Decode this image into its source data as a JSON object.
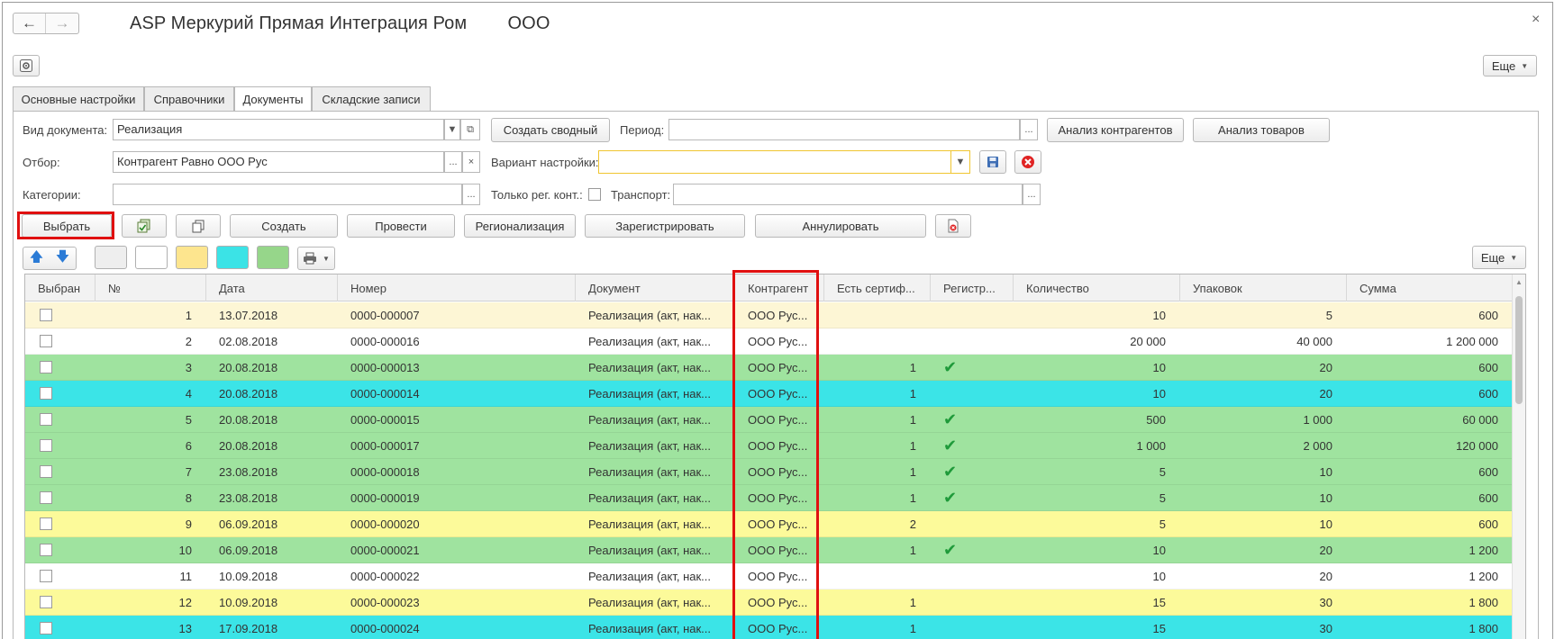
{
  "window": {
    "title": "ASP Меркурий Прямая Интеграция Ром        ООО",
    "more_label": "Еще",
    "close_glyph": "×"
  },
  "tabs": [
    {
      "label": "Основные настройки",
      "active": false
    },
    {
      "label": "Справочники",
      "active": false
    },
    {
      "label": "Документы",
      "active": true
    },
    {
      "label": "Складские записи",
      "active": false
    }
  ],
  "filters": {
    "doc_type_label": "Вид документа:",
    "doc_type_value": "Реализация",
    "create_summary_label": "Создать сводный",
    "period_label": "Период:",
    "period_value": "",
    "analyze_counterparties_label": "Анализ контрагентов",
    "analyze_goods_label": "Анализ товаров",
    "selection_label": "Отбор:",
    "selection_value": "Контрагент Равно  ООО Рус",
    "setting_variant_label": "Вариант настройки:",
    "setting_variant_value": "",
    "categories_label": "Категории:",
    "categories_value": "",
    "only_reg_label": "Только рег. конт.:",
    "transport_label": "Транспорт:",
    "transport_value": "",
    "ellipsis": "...",
    "clear": "×"
  },
  "actions": {
    "select": "Выбрать",
    "create": "Создать",
    "post": "Провести",
    "regionalize": "Регионализация",
    "register": "Зарегистрировать",
    "annul": "Аннулировать"
  },
  "table_toolbar": {
    "more_label": "Еще",
    "colors": [
      "#eeeeee",
      "#ffffff",
      "#fde58e",
      "#3be3e6",
      "#96d68a"
    ]
  },
  "colors": {
    "white": "#ffffff",
    "light_yellow": "#fdf6d5",
    "yellow": "#fcfa9a",
    "green": "#9fe39f",
    "cyan": "#3be4e7",
    "highlight_frame": "#e01010"
  },
  "table": {
    "columns": [
      "Выбран",
      "№",
      "Дата",
      "Номер",
      "Документ",
      "Контрагент",
      "Есть сертиф...",
      "Регистр...",
      "Количество",
      "Упаковок",
      "Сумма"
    ],
    "rows": [
      {
        "n": "1",
        "date": "13.07.2018",
        "number": "0000-000007",
        "doc": "Реализация (акт, нак...",
        "cp": "ООО Рус...",
        "cert": "",
        "reg": "",
        "qty": "10",
        "packs": "5",
        "sum": "600",
        "color": "light_yellow"
      },
      {
        "n": "2",
        "date": "02.08.2018",
        "number": "0000-000016",
        "doc": "Реализация (акт, нак...",
        "cp": "ООО Рус...",
        "cert": "",
        "reg": "",
        "qty": "20 000",
        "packs": "40 000",
        "sum": "1 200 000",
        "color": "white"
      },
      {
        "n": "3",
        "date": "20.08.2018",
        "number": "0000-000013",
        "doc": "Реализация (акт, нак...",
        "cp": "ООО Рус...",
        "cert": "1",
        "reg": "✔",
        "qty": "10",
        "packs": "20",
        "sum": "600",
        "color": "green"
      },
      {
        "n": "4",
        "date": "20.08.2018",
        "number": "0000-000014",
        "doc": "Реализация (акт, нак...",
        "cp": "ООО Рус...",
        "cert": "1",
        "reg": "",
        "qty": "10",
        "packs": "20",
        "sum": "600",
        "color": "cyan"
      },
      {
        "n": "5",
        "date": "20.08.2018",
        "number": "0000-000015",
        "doc": "Реализация (акт, нак...",
        "cp": "ООО Рус...",
        "cert": "1",
        "reg": "✔",
        "qty": "500",
        "packs": "1 000",
        "sum": "60 000",
        "color": "green"
      },
      {
        "n": "6",
        "date": "20.08.2018",
        "number": "0000-000017",
        "doc": "Реализация (акт, нак...",
        "cp": "ООО Рус...",
        "cert": "1",
        "reg": "✔",
        "qty": "1 000",
        "packs": "2 000",
        "sum": "120 000",
        "color": "green"
      },
      {
        "n": "7",
        "date": "23.08.2018",
        "number": "0000-000018",
        "doc": "Реализация (акт, нак...",
        "cp": "ООО Рус...",
        "cert": "1",
        "reg": "✔",
        "qty": "5",
        "packs": "10",
        "sum": "600",
        "color": "green"
      },
      {
        "n": "8",
        "date": "23.08.2018",
        "number": "0000-000019",
        "doc": "Реализация (акт, нак...",
        "cp": "ООО Рус...",
        "cert": "1",
        "reg": "✔",
        "qty": "5",
        "packs": "10",
        "sum": "600",
        "color": "green"
      },
      {
        "n": "9",
        "date": "06.09.2018",
        "number": "0000-000020",
        "doc": "Реализация (акт, нак...",
        "cp": "ООО Рус...",
        "cert": "2",
        "reg": "",
        "qty": "5",
        "packs": "10",
        "sum": "600",
        "color": "yellow"
      },
      {
        "n": "10",
        "date": "06.09.2018",
        "number": "0000-000021",
        "doc": "Реализация (акт, нак...",
        "cp": "ООО Рус...",
        "cert": "1",
        "reg": "✔",
        "qty": "10",
        "packs": "20",
        "sum": "1 200",
        "color": "green"
      },
      {
        "n": "11",
        "date": "10.09.2018",
        "number": "0000-000022",
        "doc": "Реализация (акт, нак...",
        "cp": "ООО Рус...",
        "cert": "",
        "reg": "",
        "qty": "10",
        "packs": "20",
        "sum": "1 200",
        "color": "white"
      },
      {
        "n": "12",
        "date": "10.09.2018",
        "number": "0000-000023",
        "doc": "Реализация (акт, нак...",
        "cp": "ООО Рус...",
        "cert": "1",
        "reg": "",
        "qty": "15",
        "packs": "30",
        "sum": "1 800",
        "color": "yellow"
      },
      {
        "n": "13",
        "date": "17.09.2018",
        "number": "0000-000024",
        "doc": "Реализация (акт, нак...",
        "cp": "ООО Рус...",
        "cert": "1",
        "reg": "",
        "qty": "15",
        "packs": "30",
        "sum": "1 800",
        "color": "cyan"
      }
    ]
  }
}
